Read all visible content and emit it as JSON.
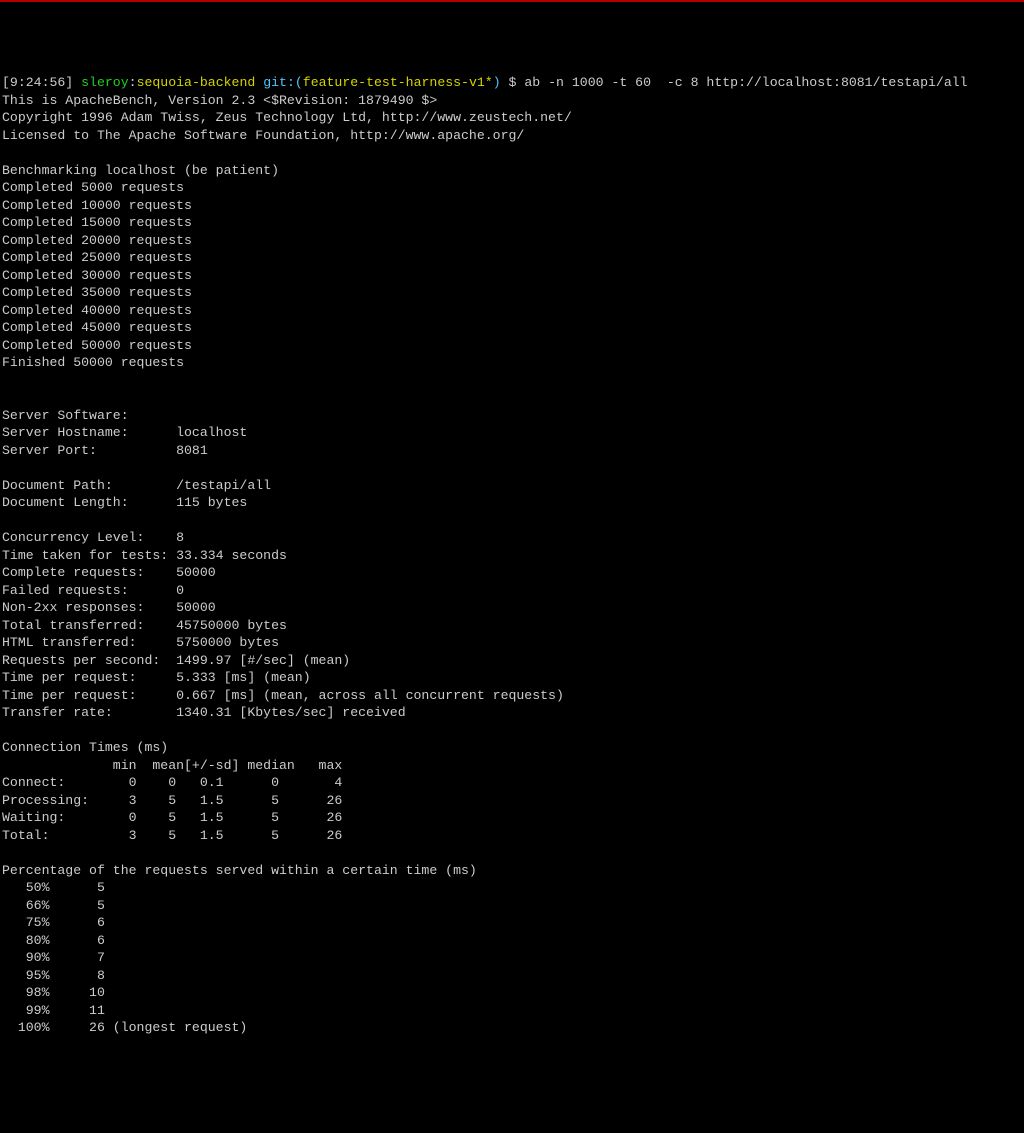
{
  "prompt": {
    "time": "[9:24:56]",
    "user": "sleroy",
    "host": "sequoia-backend",
    "gitseg": "git:(",
    "branch": "feature-test-harness-v1*",
    "gitend": ")",
    "dollar": " $ ",
    "command": "ab -n 1000 -t 60  -c 8 http://localhost:8081/testapi/all"
  },
  "intro": [
    "This is ApacheBench, Version 2.3 <$Revision: 1879490 $>",
    "Copyright 1996 Adam Twiss, Zeus Technology Ltd, http://www.zeustech.net/",
    "Licensed to The Apache Software Foundation, http://www.apache.org/",
    "",
    "Benchmarking localhost (be patient)",
    "Completed 5000 requests",
    "Completed 10000 requests",
    "Completed 15000 requests",
    "Completed 20000 requests",
    "Completed 25000 requests",
    "Completed 30000 requests",
    "Completed 35000 requests",
    "Completed 40000 requests",
    "Completed 45000 requests",
    "Completed 50000 requests",
    "Finished 50000 requests",
    "",
    ""
  ],
  "kv": [
    [
      "Server Software:",
      ""
    ],
    [
      "Server Hostname:",
      "localhost"
    ],
    [
      "Server Port:",
      "8081"
    ],
    [
      "",
      ""
    ],
    [
      "Document Path:",
      "/testapi/all"
    ],
    [
      "Document Length:",
      "115 bytes"
    ],
    [
      "",
      ""
    ],
    [
      "Concurrency Level:",
      "8"
    ],
    [
      "Time taken for tests:",
      "33.334 seconds"
    ],
    [
      "Complete requests:",
      "50000"
    ],
    [
      "Failed requests:",
      "0"
    ],
    [
      "Non-2xx responses:",
      "50000"
    ],
    [
      "Total transferred:",
      "45750000 bytes"
    ],
    [
      "HTML transferred:",
      "5750000 bytes"
    ],
    [
      "Requests per second:",
      "1499.97 [#/sec] (mean)"
    ],
    [
      "Time per request:",
      "5.333 [ms] (mean)"
    ],
    [
      "Time per request:",
      "0.667 [ms] (mean, across all concurrent requests)"
    ],
    [
      "Transfer rate:",
      "1340.31 [Kbytes/sec] received"
    ]
  ],
  "conn": {
    "title": "Connection Times (ms)",
    "header": "              min  mean[+/-sd] median   max",
    "rows": [
      [
        "Connect:",
        "0",
        "0",
        "0.1",
        "0",
        "4"
      ],
      [
        "Processing:",
        "3",
        "5",
        "1.5",
        "5",
        "26"
      ],
      [
        "Waiting:",
        "0",
        "5",
        "1.5",
        "5",
        "26"
      ],
      [
        "Total:",
        "3",
        "5",
        "1.5",
        "5",
        "26"
      ]
    ]
  },
  "pct": {
    "title": "Percentage of the requests served within a certain time (ms)",
    "rows": [
      [
        "50%",
        "5",
        ""
      ],
      [
        "66%",
        "5",
        ""
      ],
      [
        "75%",
        "6",
        ""
      ],
      [
        "80%",
        "6",
        ""
      ],
      [
        "90%",
        "7",
        ""
      ],
      [
        "95%",
        "8",
        ""
      ],
      [
        "98%",
        "10",
        ""
      ],
      [
        "99%",
        "11",
        ""
      ],
      [
        "100%",
        "26",
        "(longest request)"
      ]
    ]
  }
}
